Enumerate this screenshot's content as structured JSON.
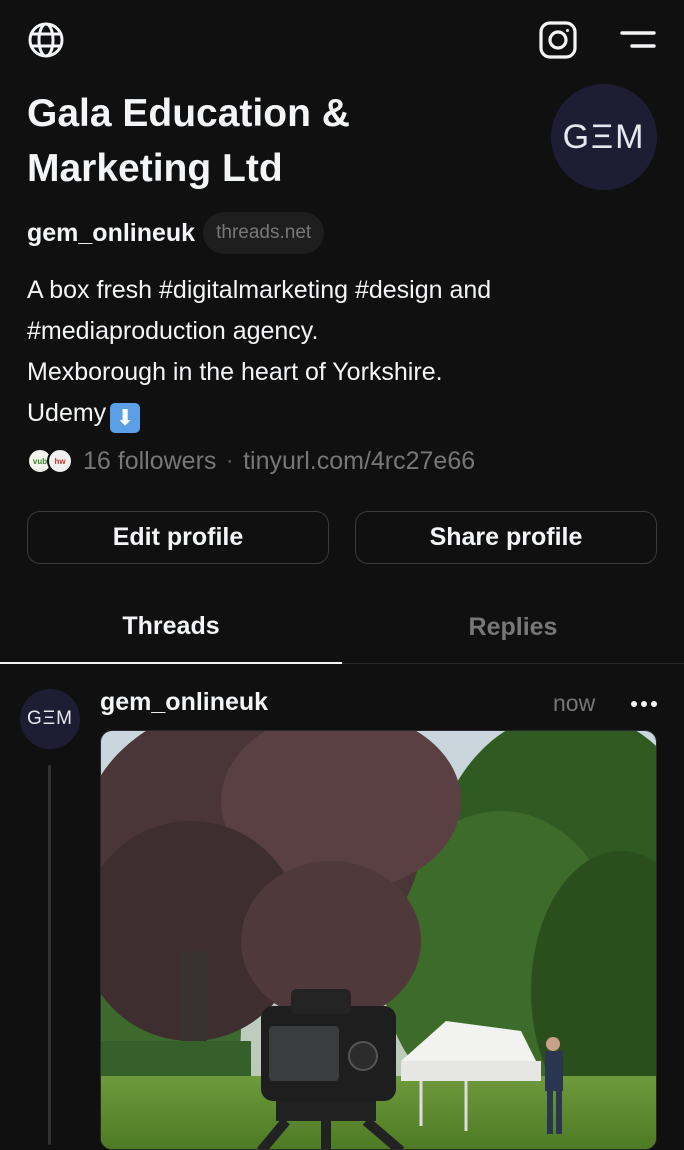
{
  "header": {
    "icons": [
      "globe-icon",
      "instagram-icon",
      "menu-icon"
    ]
  },
  "profile": {
    "name": "Gala Education & Marketing Ltd",
    "avatar_text": "GΞM",
    "handle": "gem_onlineuk",
    "domain_pill": "threads.net",
    "bio_lines": [
      "A box fresh #digitalmarketing #design and",
      "#mediaproduction agency.",
      "Mexborough in the heart of Yorkshire.",
      "Udemy"
    ],
    "bio_emoji": "⬇",
    "follower_avatars": [
      {
        "label": "vub"
      },
      {
        "label": "hw"
      }
    ],
    "followers": "16 followers",
    "separator": "·",
    "link": "tinyurl.com/4rc27e66"
  },
  "actions": {
    "edit_label": "Edit profile",
    "share_label": "Share profile"
  },
  "tabs": [
    {
      "label": "Threads",
      "active": true
    },
    {
      "label": "Replies",
      "active": false
    }
  ],
  "post": {
    "avatar_text": "GΞM",
    "username": "gem_onlineuk",
    "time": "now",
    "more_icon": "more-horizontal-icon",
    "image_name": "post-photo-camera-gazebo"
  },
  "colors": {
    "background": "#101010",
    "primary_text": "#f3f5f7",
    "secondary_text": "#777777",
    "avatar_bg": "#1f1d33"
  }
}
